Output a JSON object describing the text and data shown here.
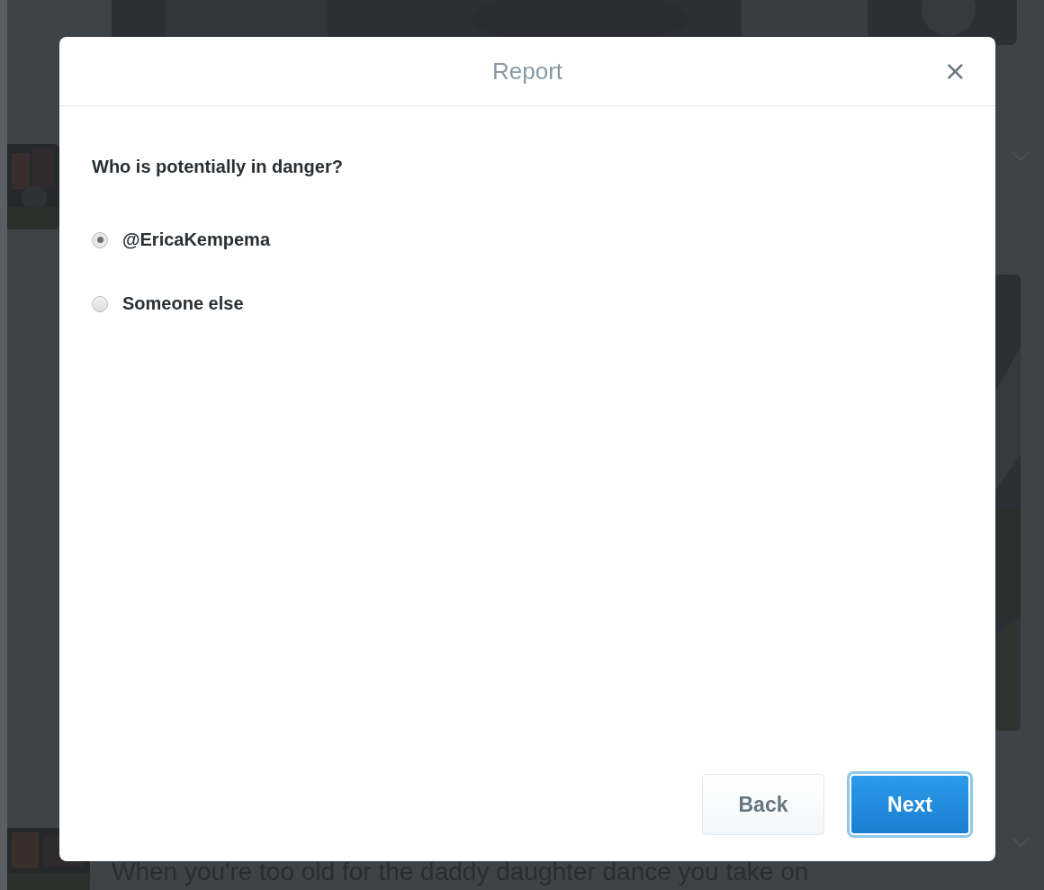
{
  "background": {
    "tweet_text": "When you're too old for the daddy daughter dance you take on"
  },
  "dialog": {
    "title": "Report",
    "close": "×",
    "question": "Who is potentially in danger?",
    "options": [
      {
        "label": "@EricaKempema",
        "selected": true
      },
      {
        "label": "Someone else",
        "selected": false
      }
    ],
    "buttons": [
      {
        "label": "Back",
        "kind": "secondary"
      },
      {
        "label": "Next",
        "kind": "primary"
      }
    ]
  }
}
